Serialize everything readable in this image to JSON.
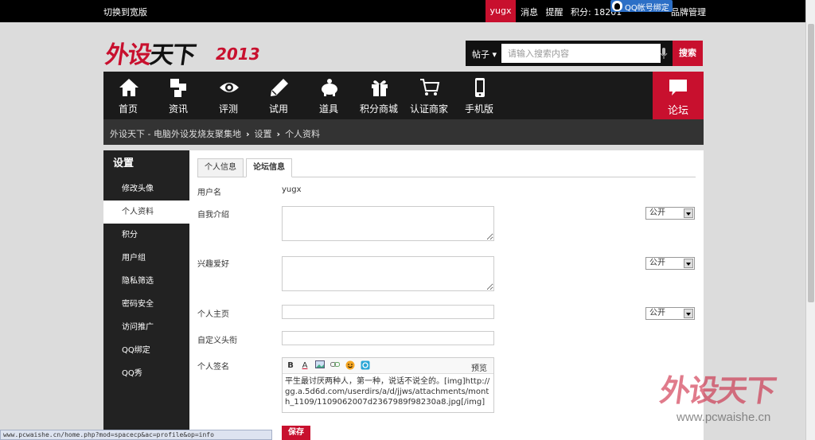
{
  "topbar": {
    "switch_wide": "切换到宽版",
    "username": "yugx",
    "messages": "消息",
    "reminders": "提醒",
    "points": "积分: 18201",
    "qq_bind": "QQ帐号绑定",
    "brand_mgmt": "品牌管理"
  },
  "logo": {
    "text_red": "外设",
    "text_black": "天下",
    "year": "2013"
  },
  "search": {
    "category": "帖子",
    "placeholder": "请输入搜索内容",
    "button": "搜索"
  },
  "nav": {
    "items": [
      {
        "label": "首页",
        "icon": "home-icon"
      },
      {
        "label": "资讯",
        "icon": "blocks-icon"
      },
      {
        "label": "评测",
        "icon": "eye-icon"
      },
      {
        "label": "试用",
        "icon": "pencil-icon"
      },
      {
        "label": "道具",
        "icon": "piggy-icon"
      },
      {
        "label": "积分商城",
        "icon": "gift-icon"
      },
      {
        "label": "认证商家",
        "icon": "cart-icon"
      },
      {
        "label": "手机版",
        "icon": "phone-icon"
      }
    ],
    "forum": "论坛"
  },
  "breadcrumb": {
    "home": "外设天下 - 电脑外设发烧友聚集地",
    "settings": "设置",
    "current": "个人资料"
  },
  "sidebar": {
    "title": "设置",
    "items": [
      "修改头像",
      "个人资料",
      "积分",
      "用户组",
      "隐私筛选",
      "密码安全",
      "访问推广",
      "QQ绑定",
      "QQ秀"
    ]
  },
  "tabs": [
    "个人信息",
    "论坛信息"
  ],
  "form": {
    "username_label": "用户名",
    "username_value": "yugx",
    "bio_label": "自我介绍",
    "hobby_label": "兴趣爱好",
    "homepage_label": "个人主页",
    "title_label": "自定义头衔",
    "signature_label": "个人签名",
    "privacy": "公开",
    "editor_preview": "预览",
    "signature_text": "平生最讨厌两种人，第一种，说话不说全的。[img]http://gg.a.5d6d.com/userdirs/a/d/jjws/attachments/month_1109/1109062007d2367989f98230a8.jpg[/img]",
    "save": "保存"
  },
  "watermark": {
    "text": "外设天下",
    "url": "www.pcwaishe.cn"
  },
  "statusbar": "www.pcwaishe.cn/home.php?mod=spacecp&ac=profile&op=info"
}
